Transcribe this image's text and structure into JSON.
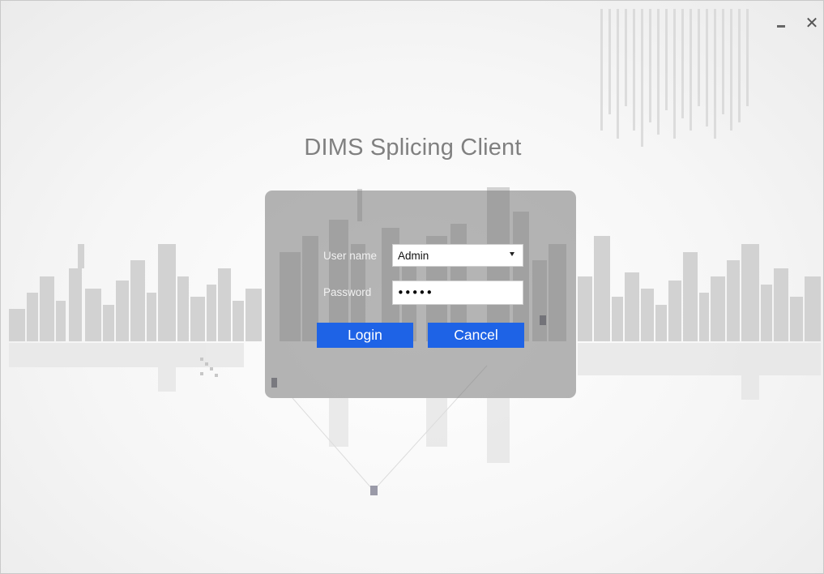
{
  "window": {
    "minimize_label": "–",
    "close_label": "✕"
  },
  "app_title": "DIMS Splicing Client",
  "login": {
    "username_label": "User name",
    "username_value": "Admin",
    "password_label": "Password",
    "password_value": "•••••",
    "login_button": "Login",
    "cancel_button": "Cancel"
  },
  "icons": {
    "minimize": "minimize-icon",
    "close": "close-icon",
    "dropdown": "chevron-down-icon"
  },
  "colors": {
    "accent": "#1e63e6",
    "panel": "#787878",
    "title": "#808080"
  }
}
